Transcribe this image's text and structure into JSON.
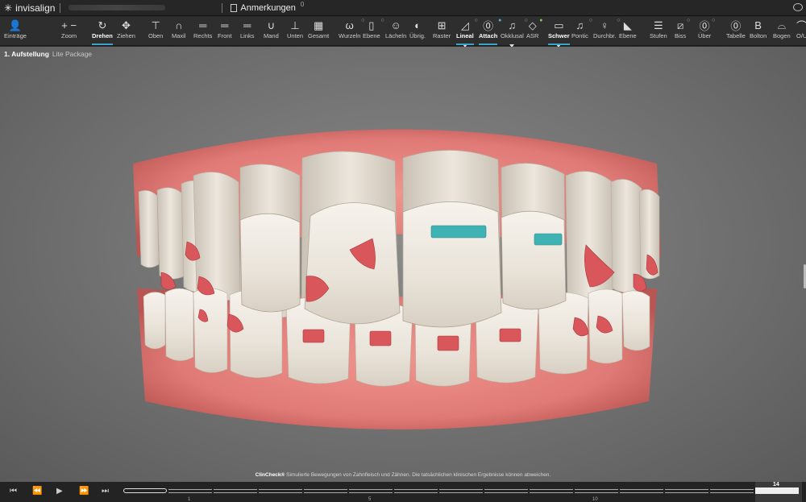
{
  "app": {
    "logo_text": "invisalign",
    "notes_label": "Anmerkungen",
    "notes_sup": "0"
  },
  "toolbar": [
    {
      "label": "Einträge",
      "icon": "person-icon",
      "glyph": "👤"
    },
    {
      "label": "Zoom",
      "icon": "zoom-icon",
      "glyph": "+ −"
    },
    {
      "label": "Drehen",
      "icon": "rotate-icon",
      "glyph": "↻",
      "active": true
    },
    {
      "label": "Ziehen",
      "icon": "pan-icon",
      "glyph": "✥"
    },
    {
      "label": "Oben",
      "icon": "view-top-icon",
      "glyph": "⊤"
    },
    {
      "label": "Maxil",
      "icon": "maxilla-icon",
      "glyph": "∩"
    },
    {
      "label": "Rechts",
      "icon": "view-right-icon",
      "glyph": "═"
    },
    {
      "label": "Front",
      "icon": "view-front-icon",
      "glyph": "═"
    },
    {
      "label": "Links",
      "icon": "view-left-icon",
      "glyph": "═"
    },
    {
      "label": "Mand",
      "icon": "mandible-icon",
      "glyph": "∪"
    },
    {
      "label": "Unten",
      "icon": "view-bottom-icon",
      "glyph": "⊥"
    },
    {
      "label": "Gesamt",
      "icon": "grid-all-icon",
      "glyph": "▦"
    },
    {
      "label": "Wurzeln",
      "icon": "roots-icon",
      "glyph": "ω",
      "dot": "○"
    },
    {
      "label": "Ebene",
      "icon": "plane-icon",
      "glyph": "▯",
      "dot": "○"
    },
    {
      "label": "Lächeln",
      "icon": "smile-icon",
      "glyph": "☺"
    },
    {
      "label": "Übrig.",
      "icon": "remaining-icon",
      "glyph": "◐"
    },
    {
      "label": "Raster",
      "icon": "raster-icon",
      "glyph": "⊞"
    },
    {
      "label": "Lineal",
      "icon": "ruler-icon",
      "glyph": "◿",
      "active": true,
      "caret": true,
      "dot": "○"
    },
    {
      "label": "Attach",
      "icon": "attachment-icon",
      "glyph": "⓪",
      "active": true,
      "dot": "●",
      "dot_class": "blue"
    },
    {
      "label": "Okklusal",
      "icon": "occlusal-icon",
      "glyph": "♫",
      "caret": true,
      "dot": "○"
    },
    {
      "label": "ASR",
      "icon": "asr-icon",
      "glyph": "◇",
      "dot": "●",
      "dot_class": "green"
    },
    {
      "label": "Schwer",
      "icon": "folder-icon",
      "glyph": "▭",
      "active": true,
      "caret": true
    },
    {
      "label": "Pontic",
      "icon": "pontic-icon",
      "glyph": "♫",
      "dot": "○"
    },
    {
      "label": "Durchbr.",
      "icon": "eruption-icon",
      "glyph": "♀",
      "dot": "○"
    },
    {
      "label": "Ebene",
      "icon": "triangle-plane-icon",
      "glyph": "◣"
    },
    {
      "label": "Stufen",
      "icon": "stages-icon",
      "glyph": "☰"
    },
    {
      "label": "Biss",
      "icon": "bite-icon",
      "glyph": "⧄",
      "dot": "○"
    },
    {
      "label": "Über",
      "icon": "overlay-icon",
      "glyph": "⓪",
      "dot": "○"
    },
    {
      "label": "Tabelle",
      "icon": "table-icon",
      "glyph": "⓪"
    },
    {
      "label": "Bolton",
      "icon": "bolton-icon",
      "glyph": "B"
    },
    {
      "label": "Bogen",
      "icon": "arch-icon",
      "glyph": "⌓"
    },
    {
      "label": "O/U",
      "icon": "upper-lower-icon",
      "glyph": "⌒"
    }
  ],
  "viewport": {
    "stage_title": "1. Aufstellung",
    "stage_sub": "Lite Package",
    "disclaimer_brand": "ClinCheck®",
    "disclaimer_text": "Simulierte Bewegungen von Zahnfleisch und Zähnen. Die tatsächlichen klinischen Ergebnisse können abweichen."
  },
  "timeline": {
    "current_stage": "14",
    "tick_1": "1",
    "tick_5": "5",
    "tick_10": "10"
  },
  "colors": {
    "gum": "#e5807c",
    "tooth": "#ece7df",
    "attachment_red": "#d9565a",
    "attachment_teal": "#3fb3b3",
    "accent": "#3aa6c9"
  }
}
